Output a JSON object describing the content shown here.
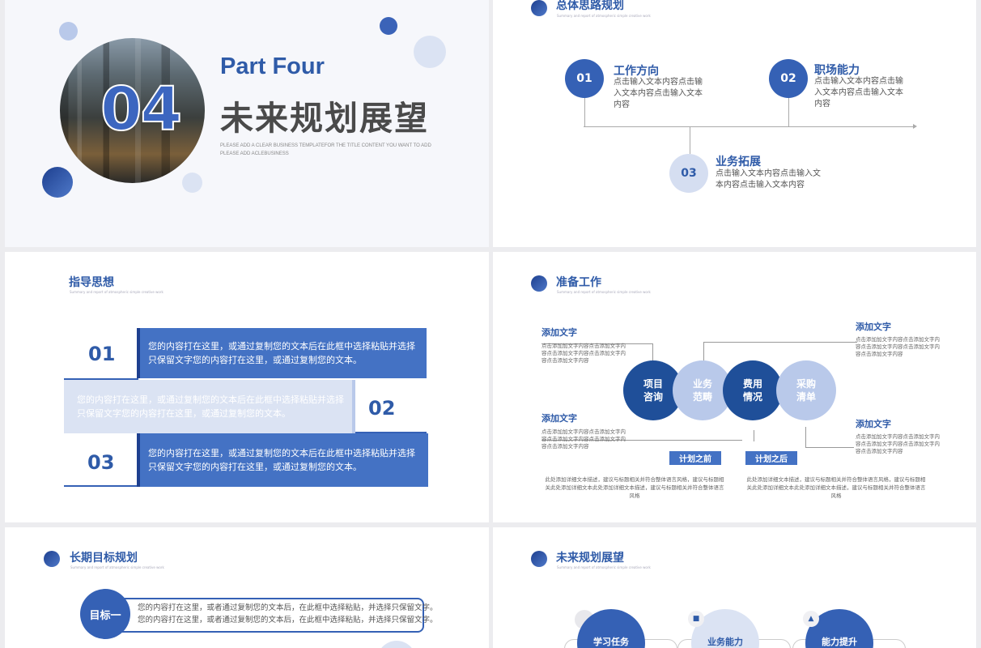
{
  "slide1": {
    "big_number": "04",
    "part": "Part Four",
    "title": "未来规划展望",
    "desc_line1": "PLEASE ADD A CLEAR BUSINESS TEMPLATEFOR THE TITLE CONTENT YOU WANT TO ADD",
    "desc_line2": "PLEASE ADD ACLEBUSINESS"
  },
  "slide2": {
    "title": "总体思路规划",
    "subtitle": "Summary and report of atmospheric simple creative work",
    "items": [
      {
        "num": "01",
        "heading": "工作方向",
        "text": "点击输入文本内容点击输入文本内容点击输入文本内容"
      },
      {
        "num": "02",
        "heading": "职场能力",
        "text": "点击输入文本内容点击输入文本内容点击输入文本内容"
      },
      {
        "num": "03",
        "heading": "业务拓展",
        "text": "点击输入文本内容点击输入文本内容点击输入文本内容"
      }
    ]
  },
  "slide3": {
    "title": "指导思想",
    "subtitle": "Summary and report of atmospheric simple creative work",
    "rows": [
      {
        "num": "01",
        "text": "您的内容打在这里，或通过复制您的文本后在此框中选择粘贴并选择只保留文字您的内容打在这里，或通过复制您的文本。"
      },
      {
        "num": "02",
        "text": "您的内容打在这里，或通过复制您的文本后在此框中选择粘贴并选择只保留文字您的内容打在这里，或通过复制您的文本。"
      },
      {
        "num": "03",
        "text": "您的内容打在这里，或通过复制您的文本后在此框中选择粘贴并选择只保留文字您的内容打在这里，或通过复制您的文本。"
      }
    ]
  },
  "slide4": {
    "title": "准备工作",
    "subtitle": "Summary and report of atmospheric simple creative work",
    "label": "添加文字",
    "label_text": "点击添加加文字内容点击添加文字内容点击添加文字内容点击添加文字内容点击添加文字内容",
    "circles": [
      {
        "line1": "项目",
        "line2": "咨询"
      },
      {
        "line1": "业务",
        "line2": "范畴"
      },
      {
        "line1": "费用",
        "line2": "情况"
      },
      {
        "line1": "采购",
        "line2": "清单"
      }
    ],
    "before_tag": "计划之前",
    "after_tag": "计划之后",
    "before_text": "此处添加详细文本描述，建议与标题相关并符合整体语言风格，建议与标题相关此处添加详细文本此处添加详细文本描述，建议与标题相关并符合整体语言风格",
    "after_text": "此处添加详细文本描述，建议与标题相关并符合整体语言风格，建议与标题相关此处添加详细文本此处添加详细文本描述，建议与标题相关并符合整体语言风格"
  },
  "slide5": {
    "title": "长期目标规划",
    "subtitle": "Summary and report of atmospheric simple creative work",
    "goal_label": "目标一",
    "goal_line1": "您的内容打在这里，或者通过复制您的文本后，在此框中选择粘贴，并选择只保留文字。",
    "goal_line2": "您的内容打在这里，或者通过复制您的文本后，在此框中选择粘贴，并选择只保留文字。"
  },
  "slide6": {
    "title": "未来规划展望",
    "subtitle": "Summary and report of atmospheric simple creative work",
    "items": [
      "学习任务",
      "业务能力",
      "能力提升"
    ]
  },
  "colors": {
    "primary": "#2f5ba8",
    "dark_blue": "#1d3f8f",
    "light_blue": "#b9c9ea",
    "pale_blue": "#dbe3f3",
    "mid_blue": "#4472c4"
  }
}
